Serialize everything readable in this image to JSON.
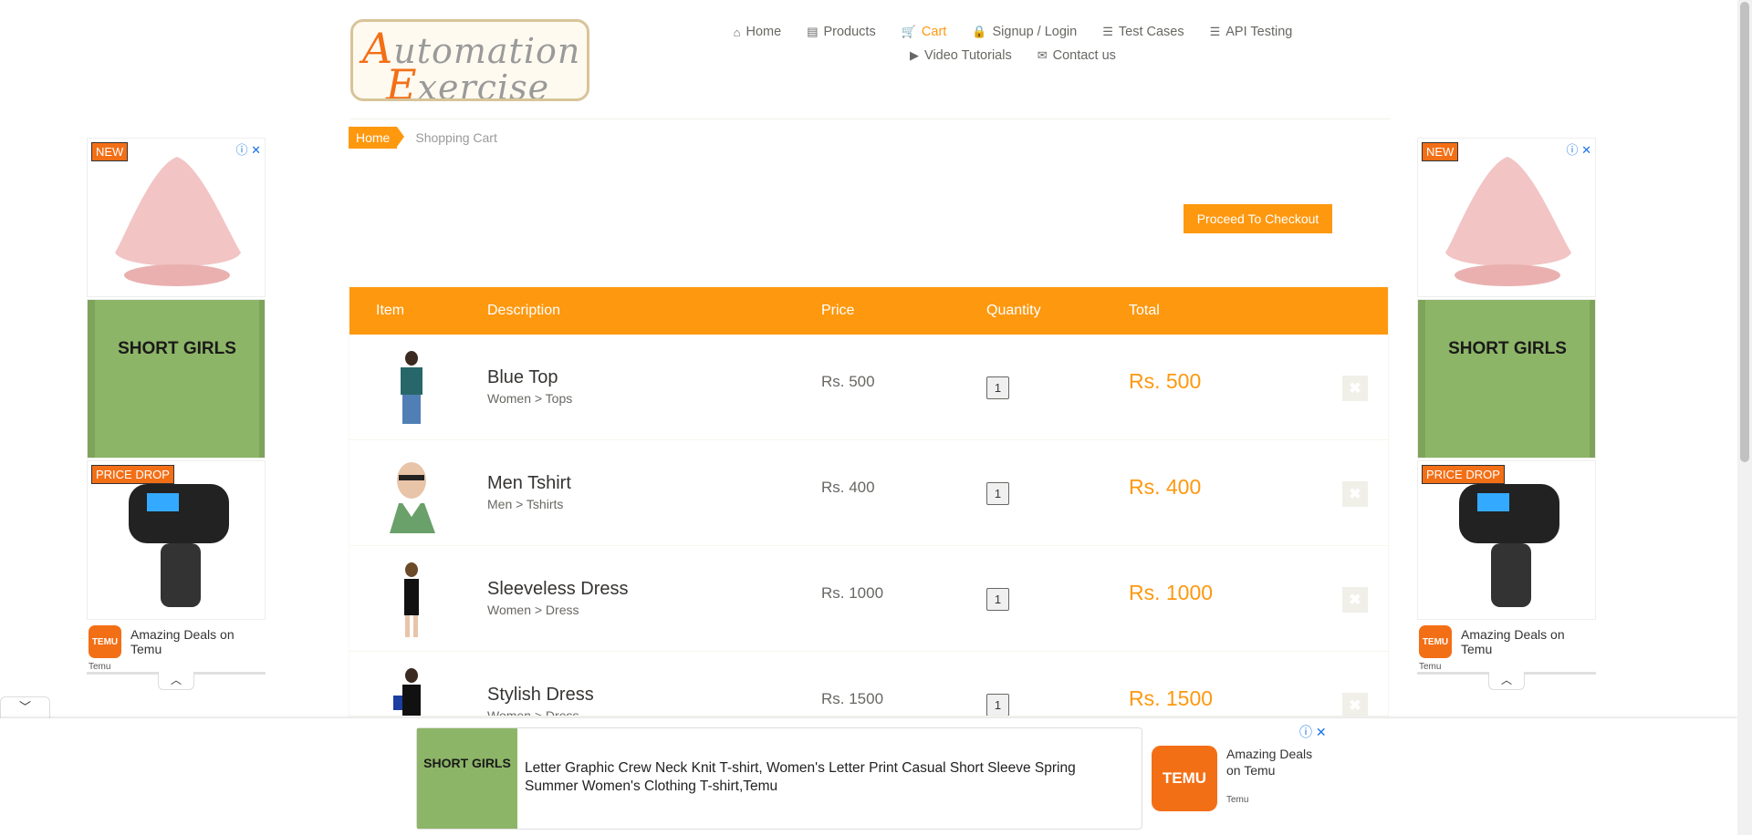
{
  "logo": {
    "line1_cap": "A",
    "line1_rest": "utomation",
    "line2_cap": "E",
    "line2_rest": "xercise"
  },
  "nav": {
    "row1": [
      {
        "icon": "home-icon",
        "glyph": "⌂",
        "label": "Home"
      },
      {
        "icon": "products-icon",
        "glyph": "▤",
        "label": "Products"
      },
      {
        "icon": "cart-icon",
        "glyph": "🛒",
        "label": "Cart",
        "active": true
      },
      {
        "icon": "lock-icon",
        "glyph": "🔒",
        "label": "Signup / Login"
      },
      {
        "icon": "list-icon",
        "glyph": "☰",
        "label": "Test Cases"
      },
      {
        "icon": "list-icon",
        "glyph": "☰",
        "label": "API Testing"
      }
    ],
    "row2": [
      {
        "icon": "video-icon",
        "glyph": "▶",
        "label": "Video Tutorials"
      },
      {
        "icon": "envelope-icon",
        "glyph": "✉",
        "label": "Contact us"
      }
    ]
  },
  "breadcrumb": {
    "home": "Home",
    "current": "Shopping Cart"
  },
  "checkout_label": "Proceed To Checkout",
  "cart": {
    "headers": {
      "item": "Item",
      "description": "Description",
      "price": "Price",
      "quantity": "Quantity",
      "total": "Total"
    },
    "rows": [
      {
        "name": "Blue Top",
        "category": "Women > Tops",
        "price": "Rs. 500",
        "quantity": "1",
        "total": "Rs. 500"
      },
      {
        "name": "Men Tshirt",
        "category": "Men > Tshirts",
        "price": "Rs. 400",
        "quantity": "1",
        "total": "Rs. 400"
      },
      {
        "name": "Sleeveless Dress",
        "category": "Women > Dress",
        "price": "Rs. 1000",
        "quantity": "1",
        "total": "Rs. 1000"
      },
      {
        "name": "Stylish Dress",
        "category": "Women > Dress",
        "price": "Rs. 1500",
        "quantity": "1",
        "total": "Rs. 1500"
      }
    ],
    "delete_glyph": "✖"
  },
  "side_ad": {
    "badge_new": "NEW",
    "badge_drop": "PRICE DROP",
    "shirt_text": "SHORT GIRLS",
    "deal": "Amazing Deals on Temu",
    "source": "Temu",
    "temu_logo": "TEMU",
    "info_glyph": "ⓘ ✕",
    "collapse_glyph": "︿"
  },
  "bottom_ad": {
    "text": "Letter Graphic Crew Neck Knit T-shirt, Women's Letter Print Casual Short Sleeve Spring Summer Women's Clothing T-shirt,Temu",
    "deal": "Amazing Deals on Temu",
    "source": "Temu",
    "temu_logo": "TEMU",
    "shirt_text": "SHORT GIRLS",
    "info_glyph": "ⓘ ✕",
    "toggle_glyph": "﹀"
  },
  "colors": {
    "accent": "#fe980f",
    "temu": "#f36f16",
    "text": "#696763"
  }
}
